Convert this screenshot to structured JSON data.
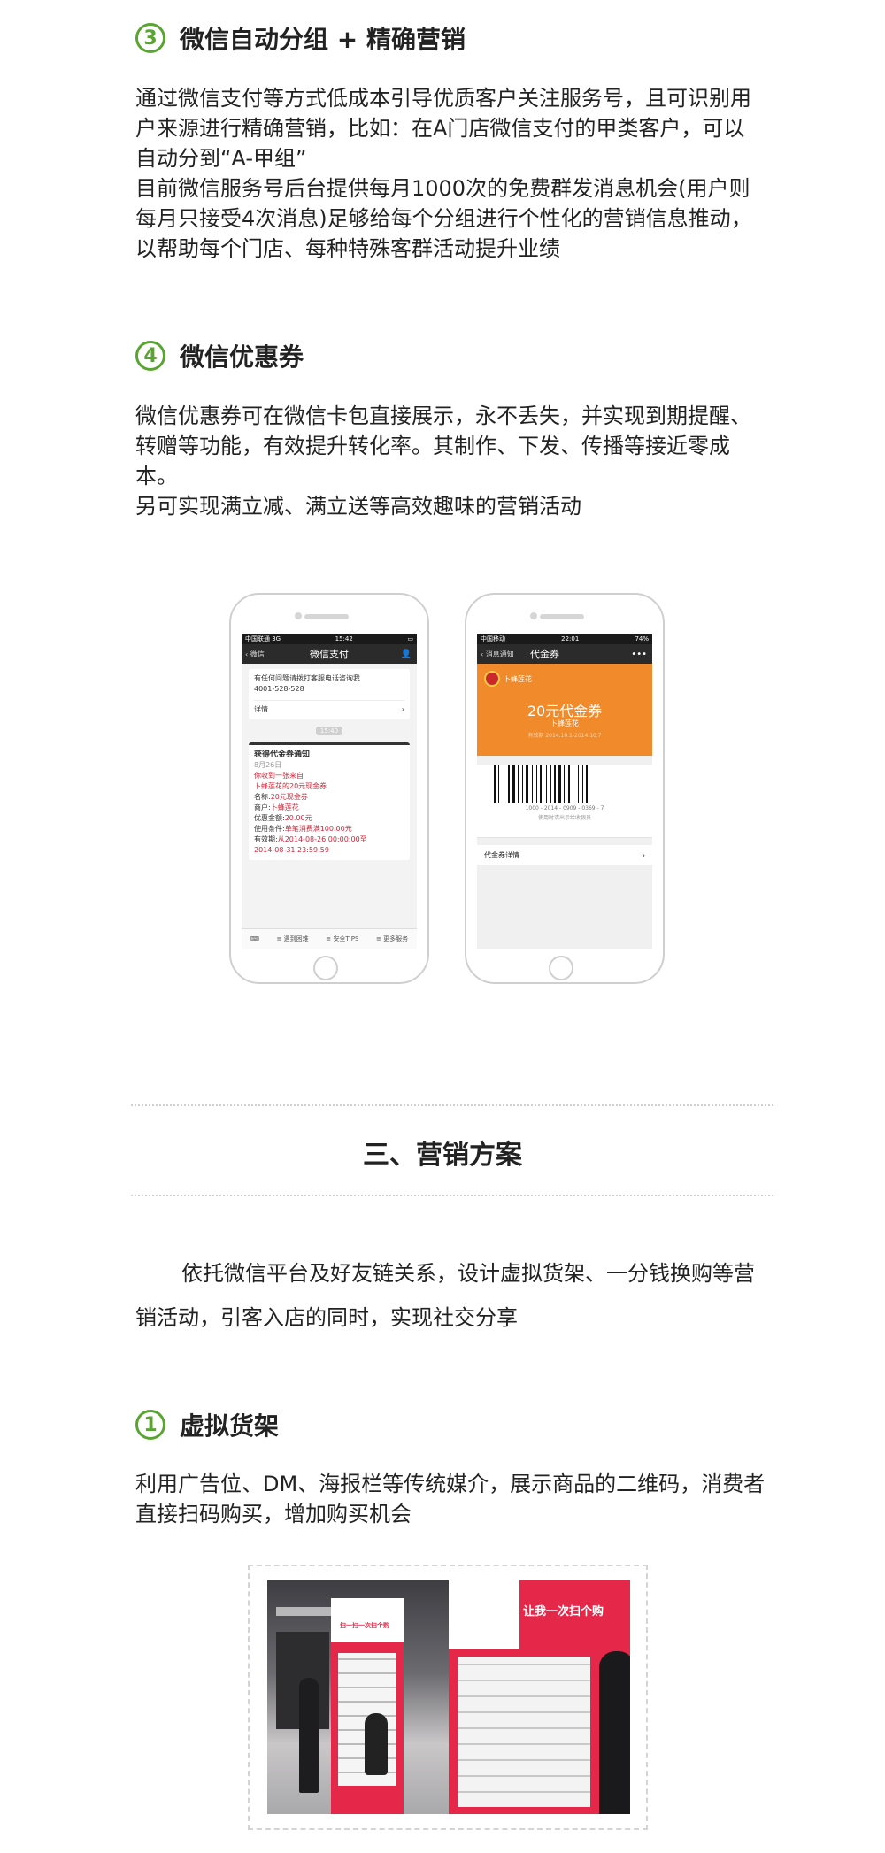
{
  "section3": {
    "number": "3",
    "title": "微信自动分组 + 精确营销",
    "paragraphs": [
      "通过微信支付等方式低成本引导优质客户关注服务号，且可识别用户来源进行精确营销，比如：在A门店微信支付的甲类客户，可以自动分到“A-甲组”",
      "目前微信服务号后台提供每月1000次的免费群发消息机会(用户则每月只接受4次消息)足够给每个分组进行个性化的营销信息推动，以帮助每个门店、每种特殊客群活动提升业绩"
    ]
  },
  "section4": {
    "number": "4",
    "title": "微信优惠券",
    "paragraphs": [
      "微信优惠券可在微信卡包直接展示，永不丢失，并实现到期提醒、转赠等功能，有效提升转化率。其制作、下发、传播等接近零成本。",
      "另可实现满立减、满立送等高效趣味的营销活动"
    ]
  },
  "phone1": {
    "status_left": "中国联通 3G",
    "status_time": "15:42",
    "back_label": "微信",
    "nav_title": "微信支付",
    "card1_line1": "有任何问题请拨打客服电话咨询我",
    "card1_line2": "4001-528-528",
    "card1_detail": "详情",
    "time_pill": "15:40",
    "notice_title": "获得代金券通知",
    "notice_date": "8月26日",
    "notice_l1": "你收到一张来自",
    "notice_l2": "卜蜂莲花的20元现金券",
    "notice_l3_label": "名称:",
    "notice_l3_value": "20元现金券",
    "notice_l4_label": "商户:",
    "notice_l4_value": "卜蜂莲花",
    "notice_l5_label": "优惠金额:",
    "notice_l5_value": "20.00元",
    "notice_l6_label": "使用条件:",
    "notice_l6_value": "单笔消费满100.00元",
    "notice_l7_label": "有效期:",
    "notice_l7_value": "从2014-08-26 00:00:00至",
    "notice_l8_value": "2014-08-31 23:59:59",
    "bottom_items": [
      "遇到困难",
      "安全TIPS",
      "更多服务"
    ]
  },
  "phone2": {
    "status_left": "中国移动",
    "status_time": "22:01",
    "status_right": "74%",
    "back_label": "消息通知",
    "nav_title": "代金券",
    "brand": "卜蜂莲花",
    "coupon_title": "20元代金券",
    "coupon_merchant": "卜蜂莲花",
    "coupon_validity": "有效期 2014.10.1-2014.10.7",
    "barcode_number": "1000 - 2014 - 0909 - 0369 - 7",
    "barcode_hint": "使用时请出示给收银员",
    "detail_label": "代金券详情"
  },
  "part3": {
    "heading": "三、营销方案",
    "intro": "依托微信平台及好友链关系，设计虚拟货架、一分钱换购等营销活动，引客入店的同时，实现社交分享"
  },
  "section1": {
    "number": "1",
    "title": "虚拟货架",
    "paragraph": "利用广告位、DM、海报栏等传统媒介，展示商品的二维码，消费者直接扫码购买，增加购买机会"
  },
  "photo": {
    "banner_left": "扫一扫一次扫个购",
    "banner_right": "让我一次扫个购"
  }
}
